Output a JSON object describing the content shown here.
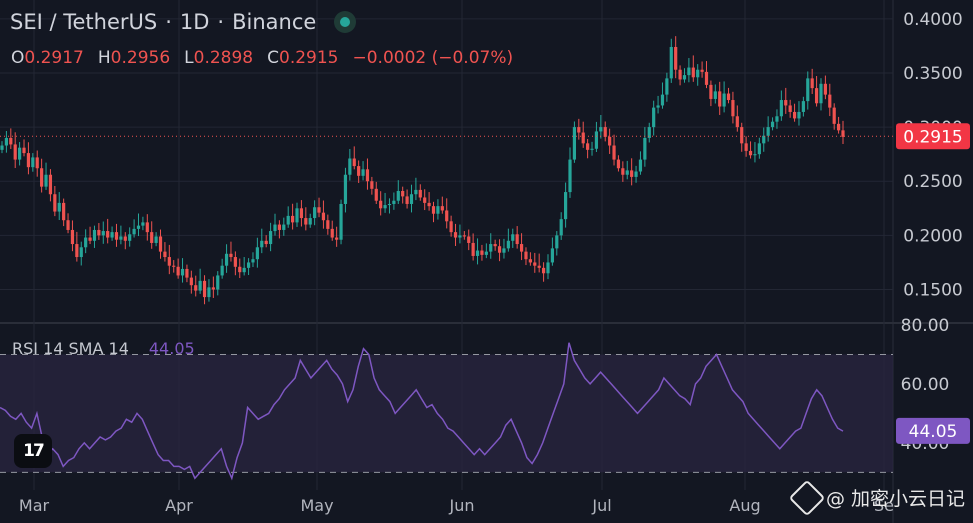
{
  "header": {
    "symbol": "SEI / TetherUS",
    "interval": "1D",
    "exchange": "Binance",
    "separator": "·"
  },
  "ohlc": {
    "open_label": "O",
    "open": "0.2917",
    "high_label": "H",
    "high": "0.2956",
    "low_label": "L",
    "low": "0.2898",
    "close_label": "C",
    "close": "0.2915",
    "change": "−0.0002 (−0.07%)"
  },
  "rsi_legend": {
    "label": "RSI 14 SMA 14",
    "value": "44.05"
  },
  "logo": {
    "text": "17"
  },
  "watermark": {
    "text": "@ 加密小云日记"
  },
  "colors": {
    "background": "#131722",
    "grid": "#232734",
    "up": "#26a69a",
    "down": "#ef5350",
    "rsi_line": "#7e57c2",
    "rsi_band": "#2a2640",
    "price_label_bg": "#f23645"
  },
  "chart_data": [
    {
      "type": "candlestick",
      "title": "SEI / TetherUS · 1D · Binance",
      "ylim": [
        0.12,
        0.41
      ],
      "yticks": [
        0.15,
        0.2,
        0.25,
        0.3,
        0.35,
        0.4
      ],
      "ytick_labels": [
        "0.1500",
        "0.2000",
        "0.2500",
        "0.3000",
        "0.3500",
        "0.4000"
      ],
      "xlabels": [
        "Mar",
        "Apr",
        "May",
        "Jun",
        "Jul",
        "Aug",
        "Se"
      ],
      "last_price": 0.2915,
      "last_price_label": "0.2915",
      "closes": [
        0.283,
        0.29,
        0.284,
        0.27,
        0.281,
        0.276,
        0.263,
        0.272,
        0.262,
        0.245,
        0.256,
        0.238,
        0.222,
        0.23,
        0.214,
        0.205,
        0.192,
        0.18,
        0.189,
        0.198,
        0.195,
        0.205,
        0.2,
        0.204,
        0.198,
        0.203,
        0.196,
        0.199,
        0.195,
        0.201,
        0.206,
        0.209,
        0.212,
        0.203,
        0.193,
        0.199,
        0.185,
        0.18,
        0.172,
        0.171,
        0.163,
        0.169,
        0.161,
        0.154,
        0.149,
        0.158,
        0.143,
        0.152,
        0.15,
        0.163,
        0.172,
        0.183,
        0.18,
        0.171,
        0.166,
        0.17,
        0.175,
        0.178,
        0.189,
        0.195,
        0.192,
        0.204,
        0.21,
        0.205,
        0.21,
        0.218,
        0.212,
        0.225,
        0.216,
        0.21,
        0.216,
        0.226,
        0.221,
        0.214,
        0.206,
        0.198,
        0.196,
        0.229,
        0.256,
        0.271,
        0.264,
        0.255,
        0.261,
        0.25,
        0.243,
        0.232,
        0.225,
        0.228,
        0.229,
        0.232,
        0.241,
        0.236,
        0.229,
        0.238,
        0.242,
        0.235,
        0.23,
        0.227,
        0.22,
        0.227,
        0.223,
        0.213,
        0.203,
        0.198,
        0.2,
        0.199,
        0.193,
        0.181,
        0.186,
        0.182,
        0.185,
        0.192,
        0.19,
        0.184,
        0.188,
        0.195,
        0.201,
        0.192,
        0.185,
        0.178,
        0.175,
        0.172,
        0.17,
        0.165,
        0.175,
        0.188,
        0.2,
        0.215,
        0.24,
        0.27,
        0.3,
        0.295,
        0.285,
        0.279,
        0.28,
        0.296,
        0.3,
        0.291,
        0.283,
        0.27,
        0.262,
        0.256,
        0.26,
        0.254,
        0.259,
        0.27,
        0.29,
        0.3,
        0.318,
        0.32,
        0.33,
        0.345,
        0.374,
        0.353,
        0.344,
        0.348,
        0.355,
        0.346,
        0.353,
        0.351,
        0.339,
        0.326,
        0.333,
        0.319,
        0.331,
        0.325,
        0.31,
        0.3,
        0.285,
        0.278,
        0.274,
        0.275,
        0.285,
        0.292,
        0.3,
        0.305,
        0.31,
        0.325,
        0.32,
        0.314,
        0.308,
        0.314,
        0.324,
        0.345,
        0.336,
        0.322,
        0.34,
        0.33,
        0.318,
        0.303,
        0.297,
        0.291
      ]
    },
    {
      "type": "line",
      "title": "RSI 14 SMA 14",
      "ylim": [
        24,
        80
      ],
      "yticks": [
        40,
        60,
        80
      ],
      "ytick_labels": [
        "40.00",
        "60.00",
        "80.00"
      ],
      "band": [
        30,
        70
      ],
      "last_value": 44.05,
      "last_value_label": "44.05",
      "values": [
        52,
        51,
        49,
        48,
        50,
        47,
        45,
        50,
        42,
        36,
        38,
        36,
        32,
        34,
        35,
        38,
        40,
        38,
        40,
        42,
        41,
        42,
        44,
        45,
        48,
        47,
        50,
        48,
        44,
        40,
        36,
        34,
        34,
        32,
        32,
        31,
        32,
        28,
        30,
        32,
        34,
        36,
        38,
        32,
        28,
        35,
        40,
        52,
        50,
        48,
        49,
        50,
        53,
        55,
        58,
        60,
        62,
        68,
        65,
        62,
        64,
        66,
        68,
        65,
        63,
        60,
        54,
        58,
        66,
        72,
        70,
        62,
        58,
        56,
        54,
        50,
        52,
        54,
        56,
        58,
        55,
        52,
        53,
        50,
        48,
        45,
        44,
        42,
        40,
        38,
        36,
        38,
        36,
        38,
        40,
        42,
        46,
        48,
        44,
        40,
        35,
        33,
        36,
        40,
        45,
        50,
        55,
        60,
        74,
        68,
        65,
        62,
        60,
        62,
        64,
        62,
        60,
        58,
        56,
        54,
        52,
        50,
        52,
        54,
        56,
        58,
        62,
        60,
        58,
        56,
        55,
        53,
        60,
        62,
        66,
        68,
        70,
        66,
        62,
        58,
        56,
        54,
        50,
        48,
        46,
        44,
        42,
        40,
        38,
        40,
        42,
        44,
        45,
        50,
        55,
        58,
        56,
        52,
        48,
        45,
        44
      ]
    }
  ]
}
